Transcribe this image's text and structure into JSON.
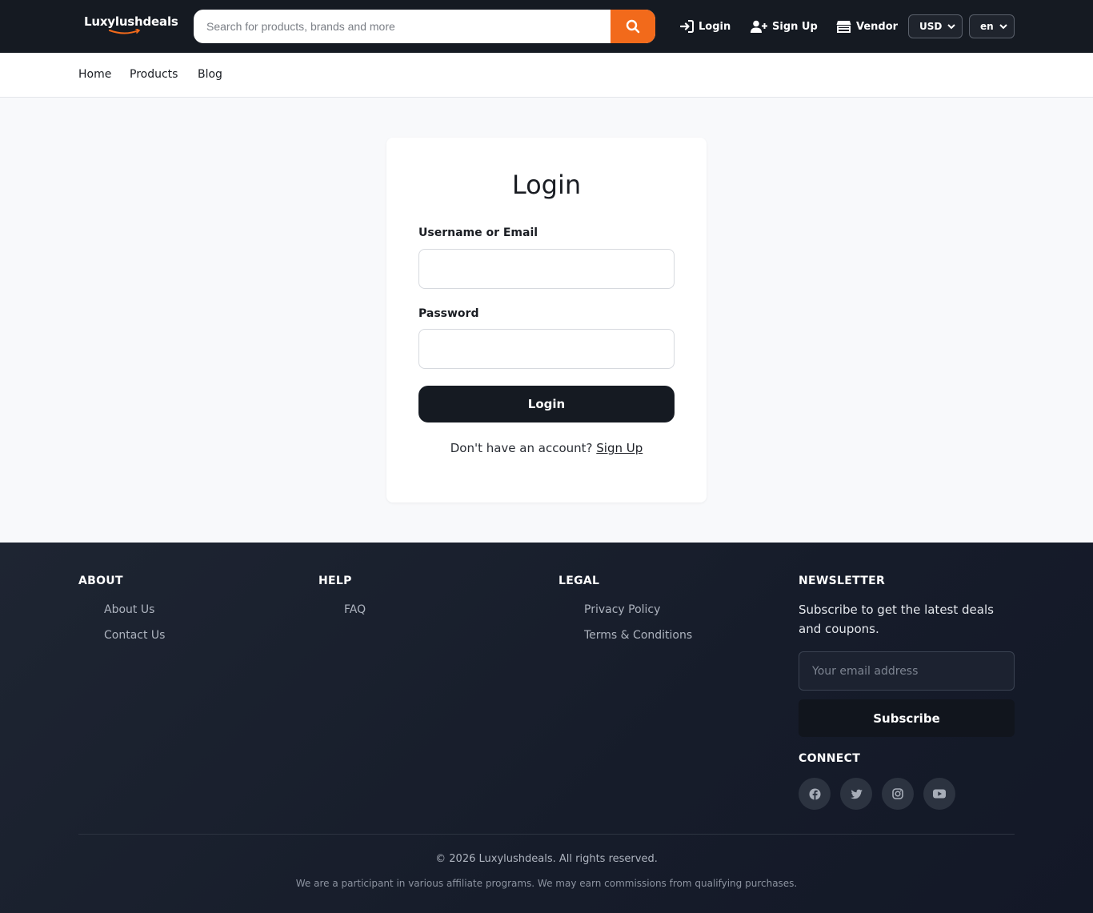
{
  "header": {
    "logo_text": "Luxylushdeals",
    "search_placeholder": "Search for products, brands and more",
    "login_label": "Login",
    "signup_label": "Sign Up",
    "vendor_label": "Vendor",
    "currency": "USD",
    "language": "en",
    "accent_color": "#f26a1b"
  },
  "subnav": {
    "items": [
      {
        "label": "Home"
      },
      {
        "label": "Products"
      },
      {
        "label": "Blog"
      }
    ]
  },
  "login_card": {
    "title": "Login",
    "username_label": "Username or Email",
    "password_label": "Password",
    "submit_label": "Login",
    "no_account_text": "Don't have an account?",
    "signup_link": "Sign Up"
  },
  "footer": {
    "about": {
      "heading": "ABOUT",
      "links": [
        "About Us",
        "Contact Us"
      ]
    },
    "help": {
      "heading": "HELP",
      "links": [
        "FAQ"
      ]
    },
    "legal": {
      "heading": "LEGAL",
      "links": [
        "Privacy Policy",
        "Terms & Conditions"
      ]
    },
    "newsletter": {
      "heading": "NEWSLETTER",
      "description": "Subscribe to get the latest deals and coupons.",
      "email_placeholder": "Your email address",
      "subscribe_label": "Subscribe"
    },
    "connect": {
      "heading": "CONNECT",
      "icons": [
        "facebook-icon",
        "twitter-icon",
        "instagram-icon",
        "youtube-icon"
      ]
    },
    "copyright": "© 2026 Luxylushdeals. All rights reserved.",
    "affiliate_notice": "We are a participant in various affiliate programs. We may earn commissions from qualifying purchases."
  }
}
